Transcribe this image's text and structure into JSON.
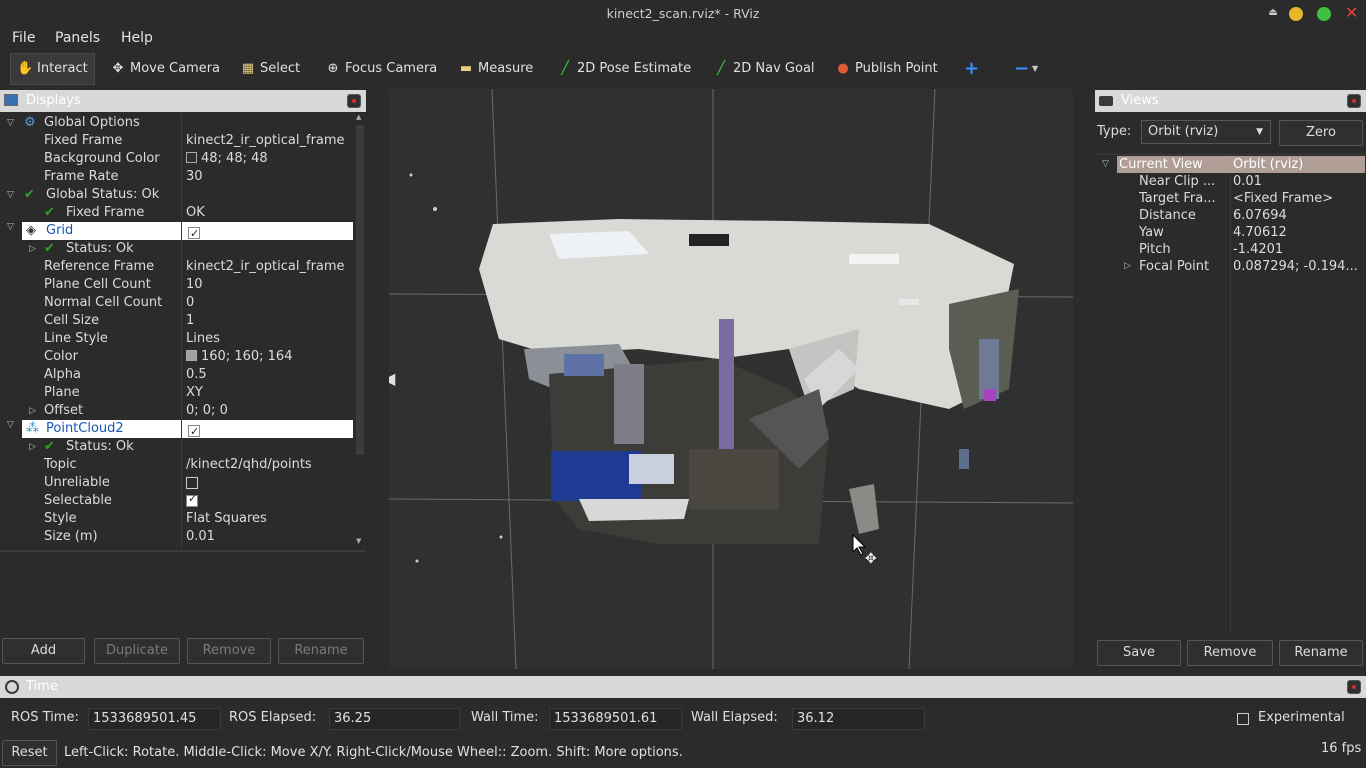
{
  "window": {
    "title": "kinect2_scan.rviz* - RViz"
  },
  "menu": {
    "file": "File",
    "panels": "Panels",
    "help": "Help"
  },
  "toolbar": {
    "interact": "Interact",
    "move_camera": "Move Camera",
    "select": "Select",
    "focus_camera": "Focus Camera",
    "measure": "Measure",
    "pose_estimate": "2D Pose Estimate",
    "nav_goal": "2D Nav Goal",
    "publish_point": "Publish Point",
    "add_glyph": "+",
    "remove_glyph": "−"
  },
  "displays": {
    "title": "Displays",
    "rows": [
      {
        "key": "Global Options",
        "value": ""
      },
      {
        "key": "Fixed Frame",
        "value": "kinect2_ir_optical_frame"
      },
      {
        "key": "Background Color",
        "value": "48; 48; 48"
      },
      {
        "key": "Frame Rate",
        "value": "30"
      },
      {
        "key": "Global Status: Ok",
        "value": ""
      },
      {
        "key": "Fixed Frame",
        "value": "OK"
      },
      {
        "key": "Grid",
        "value": ""
      },
      {
        "key": "Status: Ok",
        "value": ""
      },
      {
        "key": "Reference Frame",
        "value": "kinect2_ir_optical_frame"
      },
      {
        "key": "Plane Cell Count",
        "value": "10"
      },
      {
        "key": "Normal Cell Count",
        "value": "0"
      },
      {
        "key": "Cell Size",
        "value": "1"
      },
      {
        "key": "Line Style",
        "value": "Lines"
      },
      {
        "key": "Color",
        "value": "160; 160; 164"
      },
      {
        "key": "Alpha",
        "value": "0.5"
      },
      {
        "key": "Plane",
        "value": "XY"
      },
      {
        "key": "Offset",
        "value": "0; 0; 0"
      },
      {
        "key": "PointCloud2",
        "value": ""
      },
      {
        "key": "Status: Ok",
        "value": ""
      },
      {
        "key": "Topic",
        "value": "/kinect2/qhd/points"
      },
      {
        "key": "Unreliable",
        "value": ""
      },
      {
        "key": "Selectable",
        "value": ""
      },
      {
        "key": "Style",
        "value": "Flat Squares"
      },
      {
        "key": "Size (m)",
        "value": "0.01"
      }
    ],
    "buttons": {
      "add": "Add",
      "duplicate": "Duplicate",
      "remove": "Remove",
      "rename": "Rename"
    }
  },
  "views": {
    "title": "Views",
    "type_label": "Type:",
    "type_value": "Orbit (rviz)",
    "zero": "Zero",
    "rows": [
      {
        "key": "Current View",
        "value": "Orbit (rviz)"
      },
      {
        "key": "Near Clip ...",
        "value": "0.01"
      },
      {
        "key": "Target Fra...",
        "value": "<Fixed Frame>"
      },
      {
        "key": "Distance",
        "value": "6.07694"
      },
      {
        "key": "Yaw",
        "value": "4.70612"
      },
      {
        "key": "Pitch",
        "value": "-1.4201"
      },
      {
        "key": "Focal Point",
        "value": "0.087294; -0.194..."
      }
    ],
    "buttons": {
      "save": "Save",
      "remove": "Remove",
      "rename": "Rename"
    }
  },
  "time": {
    "title": "Time",
    "ros_time_label": "ROS Time:",
    "ros_time": "1533689501.45",
    "ros_elapsed_label": "ROS Elapsed:",
    "ros_elapsed": "36.25",
    "wall_time_label": "Wall Time:",
    "wall_time": "1533689501.61",
    "wall_elapsed_label": "Wall Elapsed:",
    "wall_elapsed": "36.12",
    "experimental": "Experimental"
  },
  "status": {
    "reset": "Reset",
    "hint": "Left-Click: Rotate. Middle-Click: Move X/Y. Right-Click/Mouse Wheel:: Zoom. Shift: More options.",
    "fps": "16 fps"
  },
  "colors": {
    "accent": "#1a55b5",
    "ok": "#2fa02f",
    "panel_header": "#d8d8d8",
    "background": "#303030"
  }
}
